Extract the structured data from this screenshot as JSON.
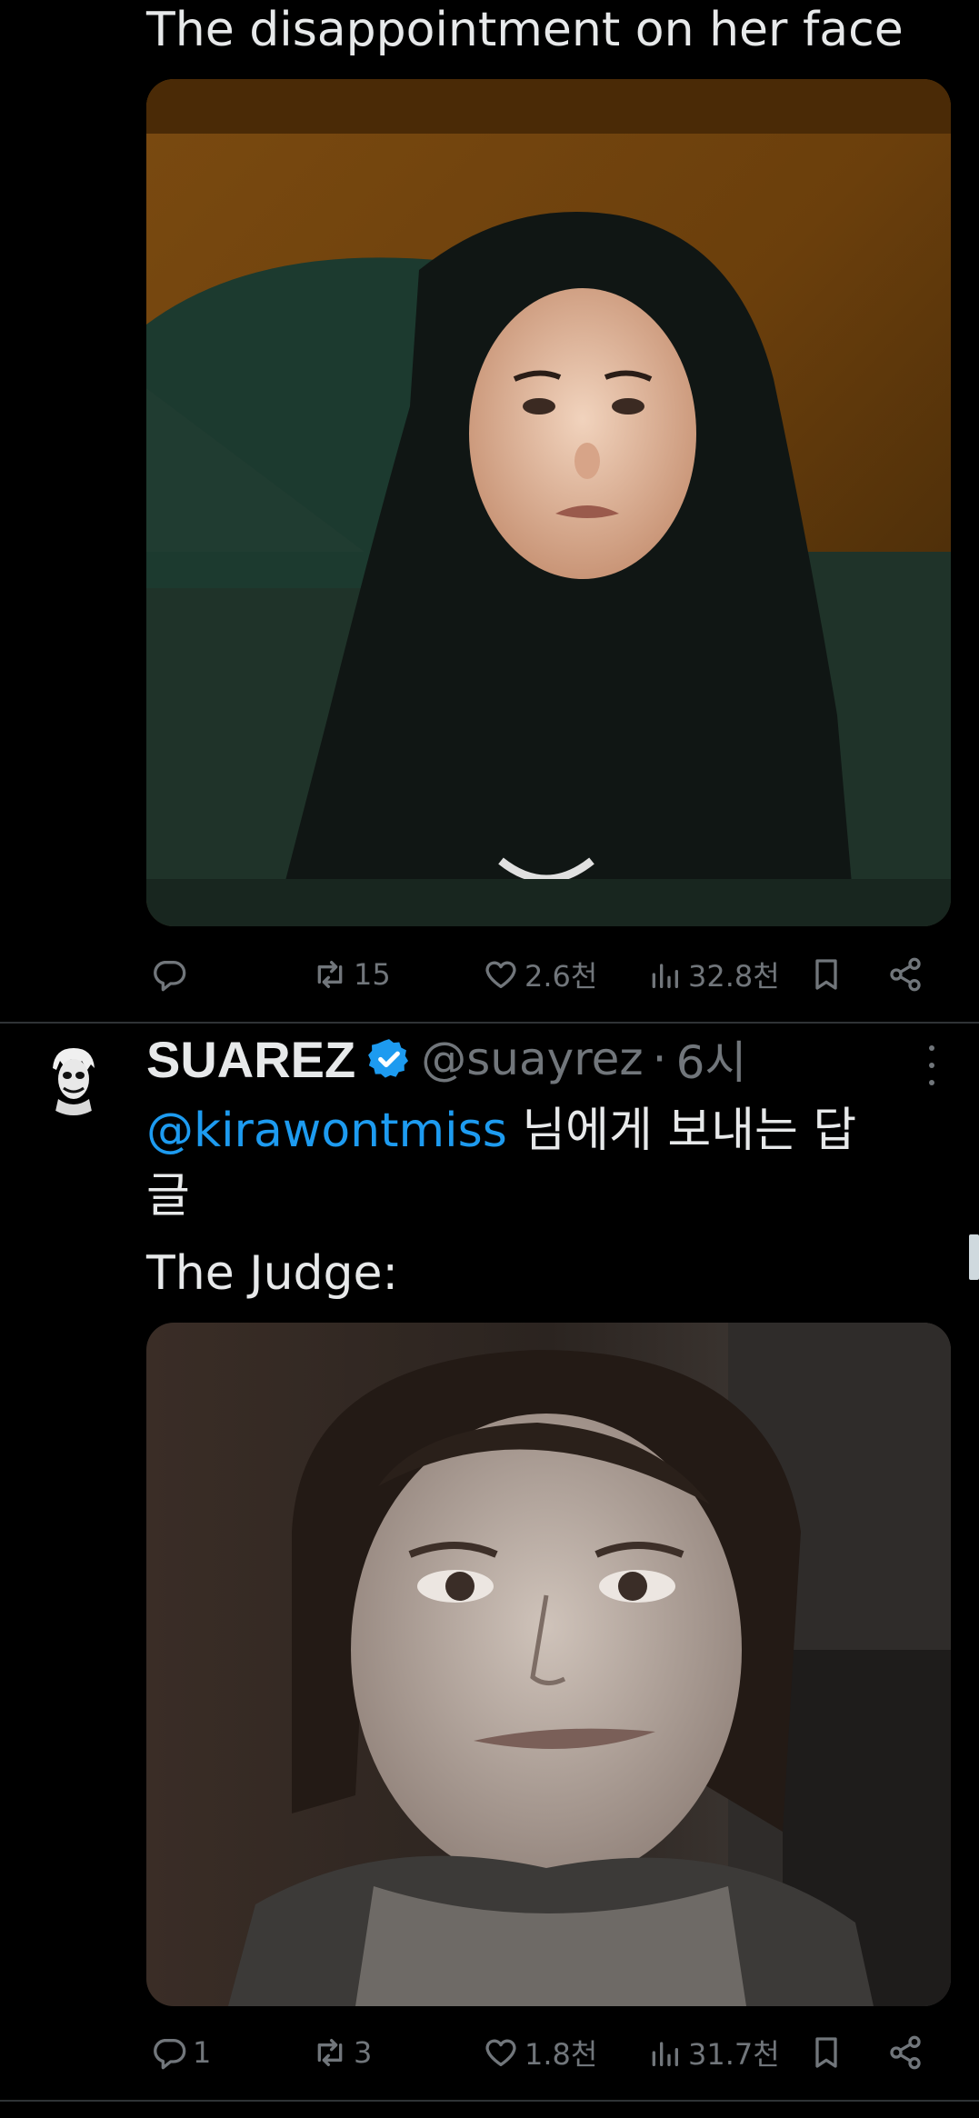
{
  "tweet1": {
    "text": "The disappointment on her face",
    "actions": {
      "reply_count": "",
      "retweet_count": "15",
      "like_count": "2.6천",
      "views_count": "32.8천"
    }
  },
  "tweet2": {
    "display_name": "SUAREZ",
    "handle": "@suayrez",
    "separator": "·",
    "time": "6시",
    "reply_to_mention": "@kirawontmiss",
    "reply_to_suffix": " 님에게 보내는 답글",
    "text": "The Judge:",
    "actions": {
      "reply_count": "1",
      "retweet_count": "3",
      "like_count": "1.8천",
      "views_count": "31.7천"
    }
  },
  "colors": {
    "background": "#000000",
    "text_primary": "#e7e9ea",
    "text_secondary": "#71767b",
    "accent": "#1d9bf0",
    "divider": "#2f3336"
  },
  "icons": [
    "reply-icon",
    "retweet-icon",
    "like-icon",
    "views-icon",
    "bookmark-icon",
    "share-icon",
    "verified-badge-icon",
    "more-icon"
  ]
}
